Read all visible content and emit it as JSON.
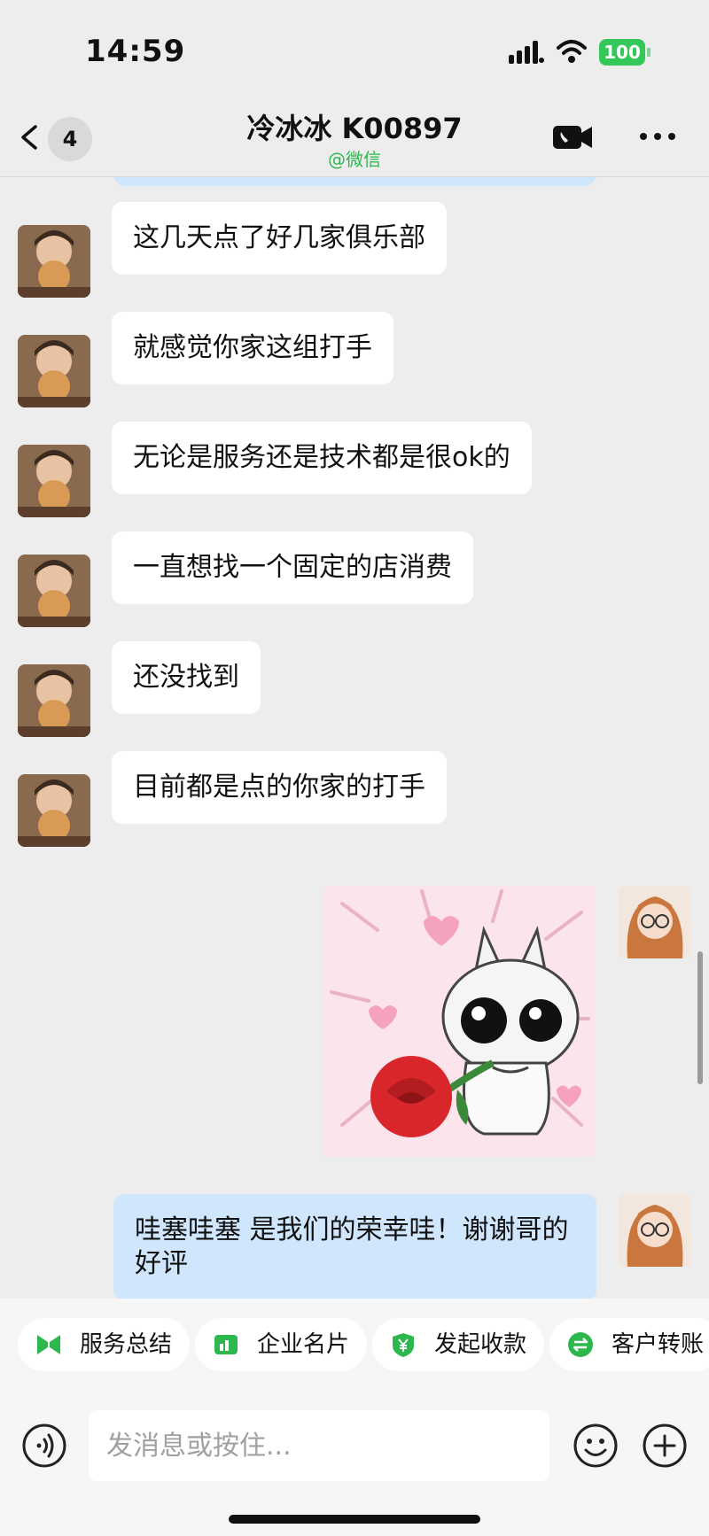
{
  "status_bar": {
    "time": "14:59",
    "battery": "100"
  },
  "nav": {
    "back_count": "4",
    "title": "冷冰冰 K00897",
    "subtitle": "@微信"
  },
  "messages": [
    {
      "side": "left",
      "text": "这几天点了好几家俱乐部"
    },
    {
      "side": "left",
      "text": "就感觉你家这组打手"
    },
    {
      "side": "left",
      "text": "无论是服务还是技术都是很ok的"
    },
    {
      "side": "left",
      "text": "一直想找一个固定的店消费"
    },
    {
      "side": "left",
      "text": "还没找到"
    },
    {
      "side": "left",
      "text": "目前都是点的你家的打手"
    },
    {
      "side": "right",
      "type": "sticker",
      "icon": "cat-with-rose-sticker"
    },
    {
      "side": "right",
      "text": "哇塞哇塞 是我们的荣幸哇！谢谢哥的好评"
    }
  ],
  "quick_actions": [
    {
      "label": "服务总结",
      "icon": "bow-icon"
    },
    {
      "label": "企业名片",
      "icon": "card-icon"
    },
    {
      "label": "发起收款",
      "icon": "yen-shield-icon"
    },
    {
      "label": "客户转账",
      "icon": "transfer-icon"
    }
  ],
  "input": {
    "placeholder": "发消息或按住..."
  },
  "colors": {
    "accent_green": "#2db84d",
    "outgoing_bubble": "#cfe6fc",
    "incoming_bubble": "#ffffff",
    "background": "#ededed"
  }
}
